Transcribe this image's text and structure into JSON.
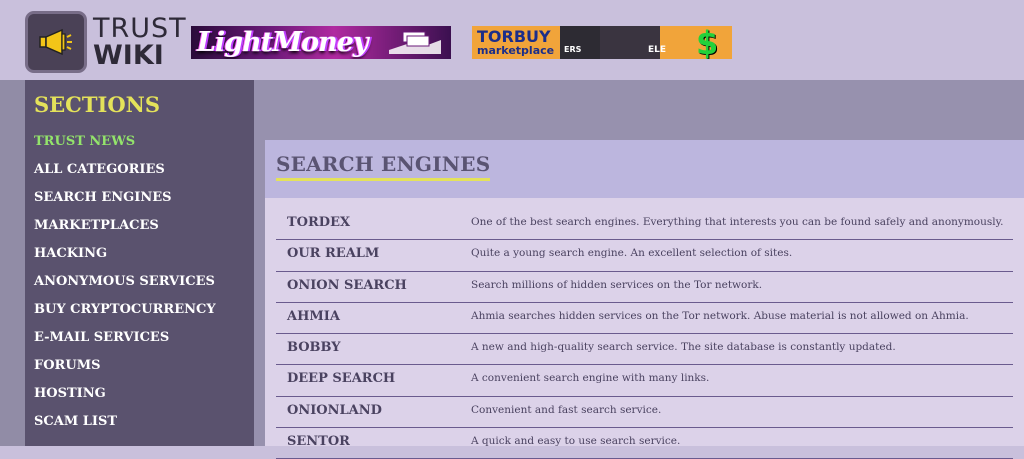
{
  "header": {
    "logo_line1": "TRUST",
    "logo_line2": "WIKI",
    "logo_icon": "megaphone-icon",
    "banners": [
      {
        "text": "LightMoney"
      },
      {
        "name": "TORBUY",
        "sub": "marketplace",
        "label1": "ERS",
        "label2": "ELE",
        "symbol": "$"
      }
    ]
  },
  "sidebar": {
    "heading": "SECTIONS",
    "items": [
      {
        "label": "TRUST NEWS",
        "active": true
      },
      {
        "label": "ALL CATEGORIES"
      },
      {
        "label": "SEARCH ENGINES"
      },
      {
        "label": "MARKETPLACES"
      },
      {
        "label": "HACKING"
      },
      {
        "label": "ANONYMOUS SERVICES"
      },
      {
        "label": "BUY CRYPTOCURRENCY"
      },
      {
        "label": "E-MAIL SERVICES"
      },
      {
        "label": "FORUMS"
      },
      {
        "label": "HOSTING"
      },
      {
        "label": "SCAM LIST"
      }
    ]
  },
  "main": {
    "title": "SEARCH ENGINES",
    "entries": [
      {
        "name": "TORDEX",
        "desc": "One of the best search engines. Everything that interests you can be found safely and anonymously."
      },
      {
        "name": "OUR REALM",
        "desc": "Quite a young search engine. An excellent selection of sites."
      },
      {
        "name": "ONION SEARCH",
        "desc": "Search millions of hidden services on the Tor network."
      },
      {
        "name": "AHMIA",
        "desc": "Ahmia searches hidden services on the Tor network. Abuse material is not allowed on Ahmia."
      },
      {
        "name": "BOBBY",
        "desc": "A new and high-quality search service. The site database is constantly updated."
      },
      {
        "name": "DEEP SEARCH",
        "desc": "A convenient search engine with many links."
      },
      {
        "name": "ONIONLAND",
        "desc": "Convenient and fast search service."
      },
      {
        "name": "SENTOR",
        "desc": "A quick and easy to use search service."
      }
    ]
  },
  "colors": {
    "accent_yellow": "#e4e25a",
    "active_green": "#93e46b",
    "sidebar_bg": "#5a526e",
    "page_bg": "#c9c0dc",
    "card_bg": "#dcd2e9"
  }
}
